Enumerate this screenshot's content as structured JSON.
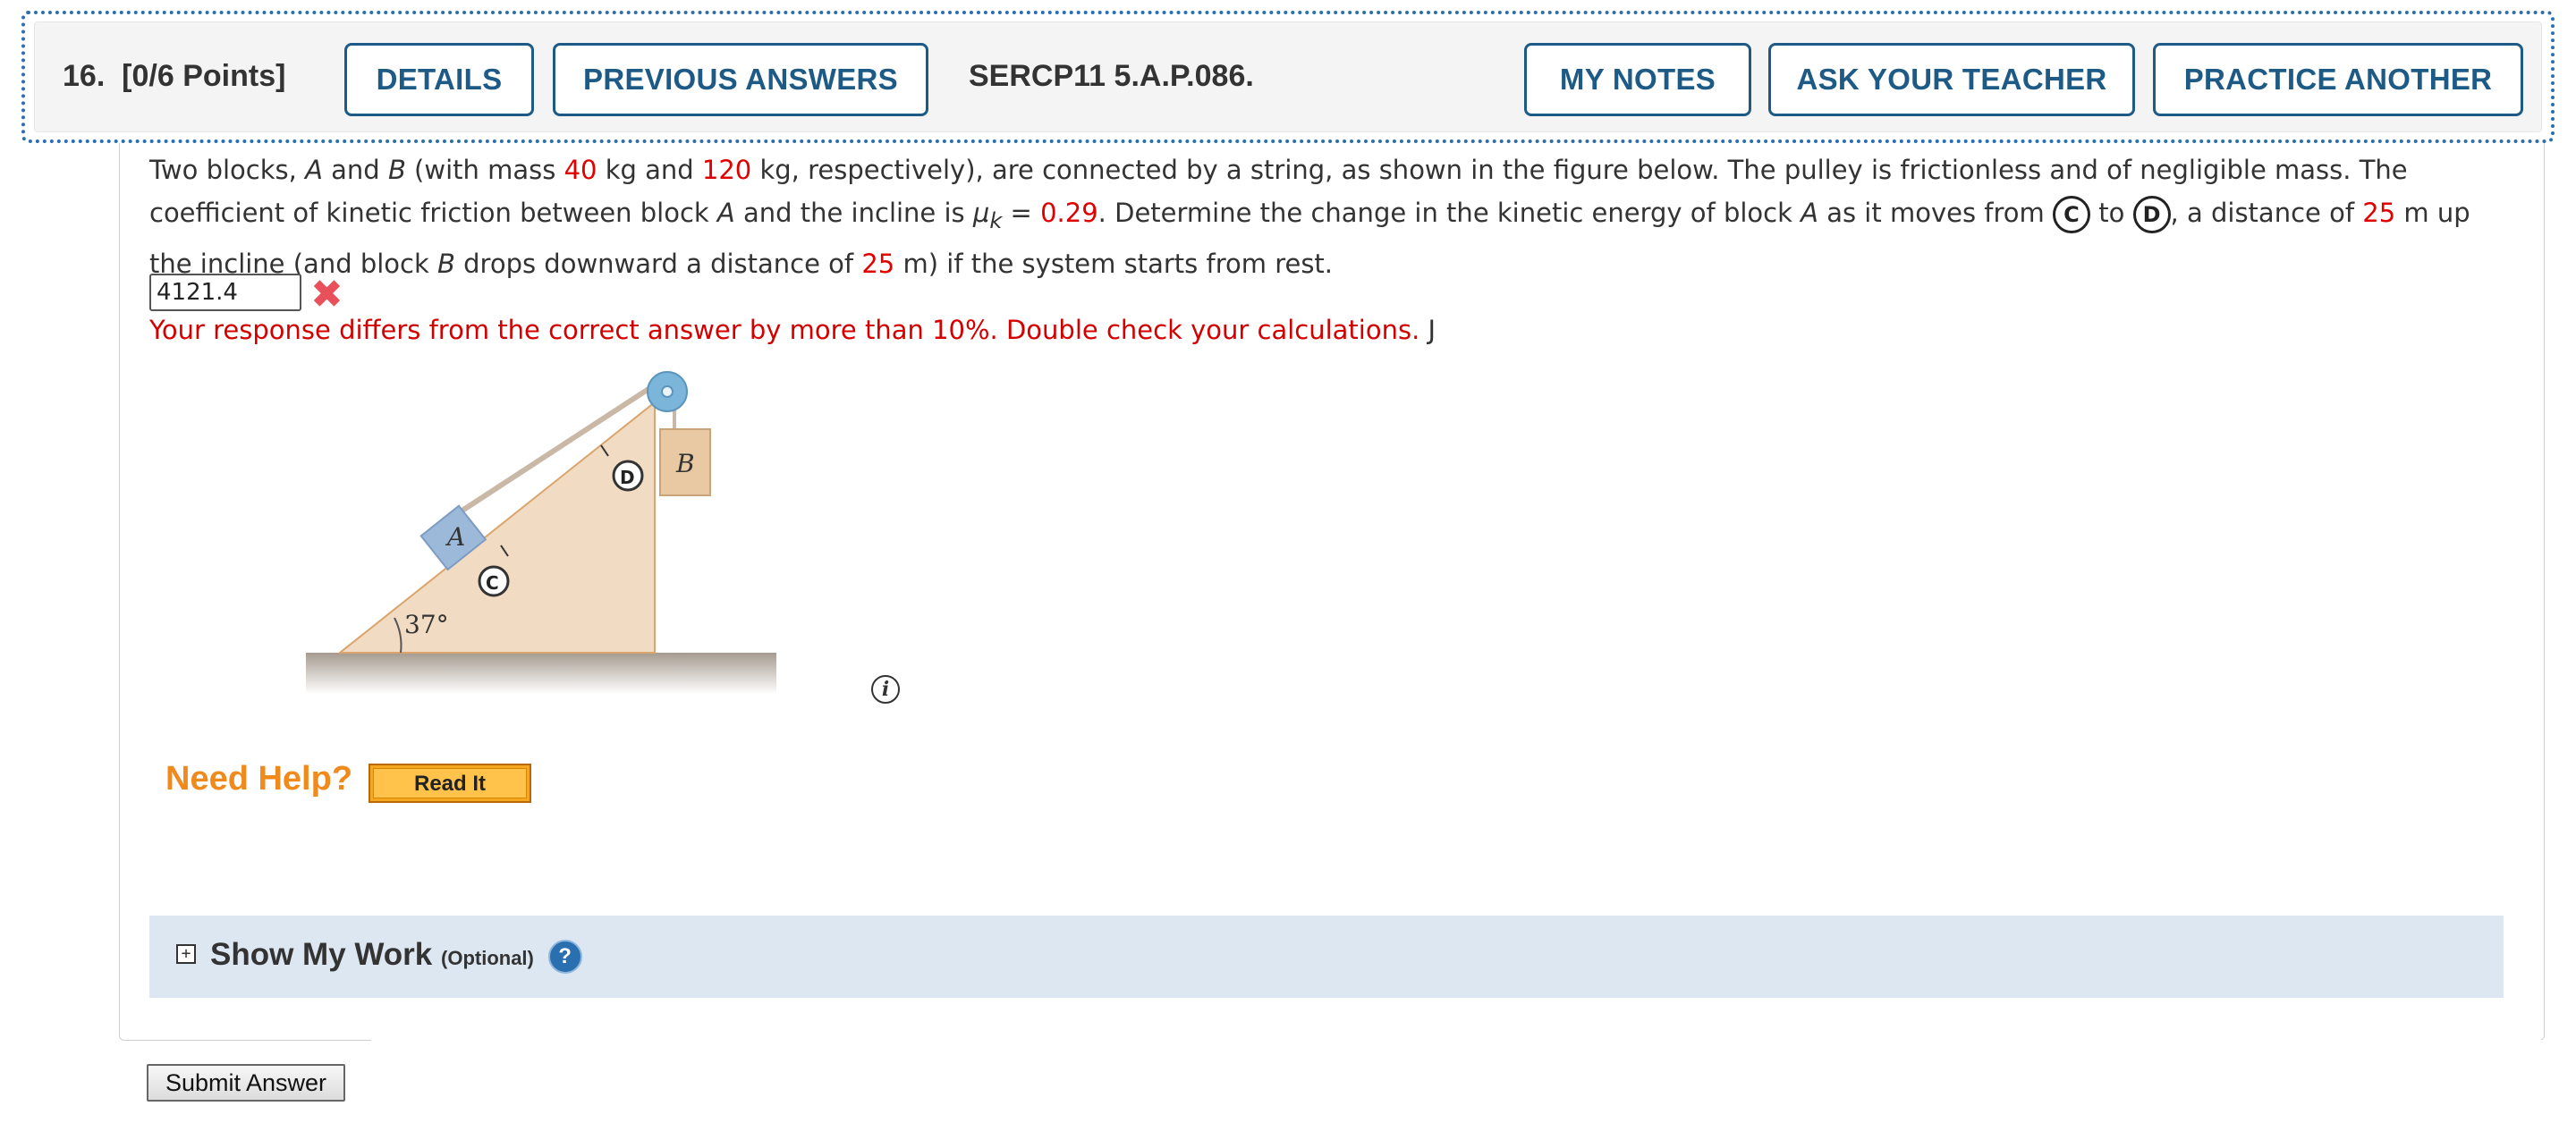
{
  "toolbar": {
    "question_number": "16.",
    "points": "[0/6 Points]",
    "details_label": "DETAILS",
    "previous_answers_label": "PREVIOUS ANSWERS",
    "problem_code": "SERCP11 5.A.P.086.",
    "my_notes_label": "MY NOTES",
    "ask_teacher_label": "ASK YOUR TEACHER",
    "practice_another_label": "PRACTICE ANOTHER"
  },
  "question": {
    "t1": "Two blocks, ",
    "a1": "A",
    "t2": " and ",
    "b1": "B",
    "t3": " (with mass ",
    "mass_a": "40",
    "t4": " kg and ",
    "mass_b": "120",
    "t5": " kg, respectively), are connected by a string, as shown in the figure below. The pulley is frictionless and of negligible mass. The coefficient of kinetic friction between block ",
    "a2": "A",
    "t6": " and the incline is ",
    "mu": "μ",
    "mu_sub": "k",
    "t7": " = ",
    "mu_value": "0.29",
    "t8": ". Determine the change in the kinetic energy of block ",
    "a3": "A",
    "t9": " as it moves from ",
    "point_c": "C",
    "t10": " to ",
    "point_d": "D",
    "t11": ", a distance of ",
    "dist_up": "25",
    "t12": " m up the incline (and block ",
    "b2": "B",
    "t13": " drops downward a distance of ",
    "dist_down": "25",
    "t14": " m) if the system starts from rest."
  },
  "answer": {
    "value": "4121.4",
    "feedback": "Your response differs from the correct answer by more than 10%. Double check your calculations.",
    "unit": "J"
  },
  "figure": {
    "block_a_label": "A",
    "block_b_label": "B",
    "point_c_label": "C",
    "point_d_label": "D",
    "angle_label": "37°",
    "colors": {
      "incline": "#f1dcc3",
      "block_a": "#9db9da",
      "block_b": "#e8c9a3",
      "ground": "#bfb6ad",
      "pulley": "#7bb5d9"
    }
  },
  "help": {
    "label": "Need Help?",
    "read_it_label": "Read It"
  },
  "show_my_work": {
    "title": "Show My Work",
    "optional": "(Optional)",
    "help_glyph": "?"
  },
  "submit_label": "Submit Answer"
}
